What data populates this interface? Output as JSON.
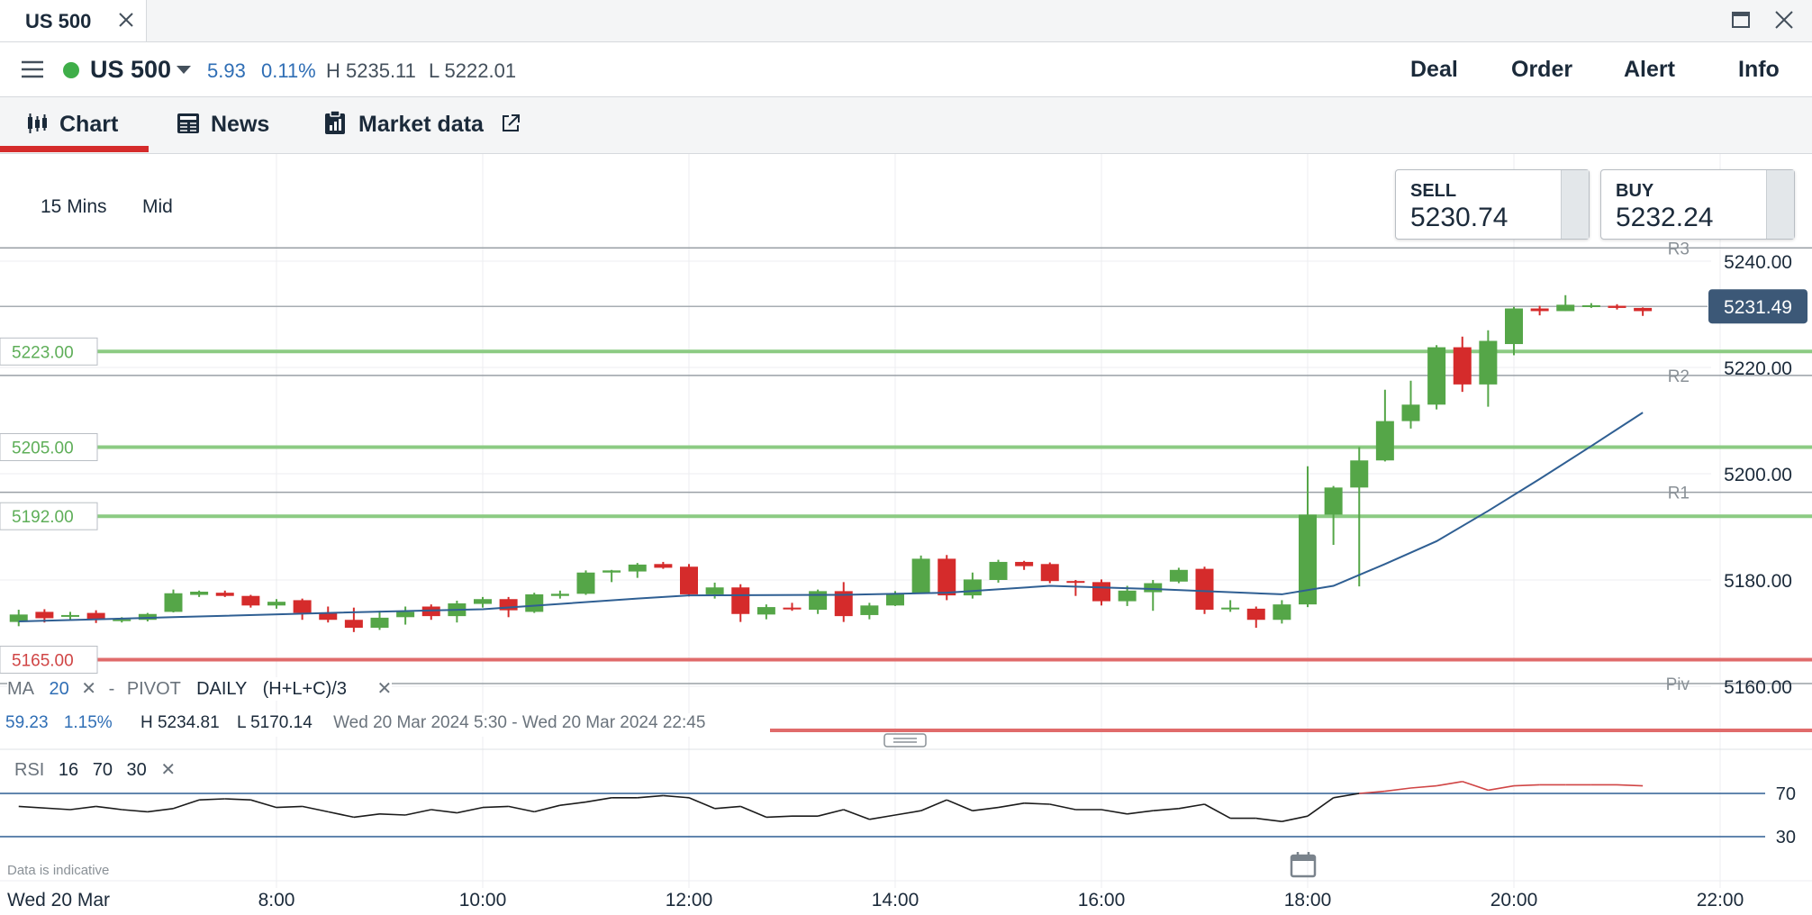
{
  "window": {
    "tab_title": "US 500"
  },
  "instrument": {
    "name": "US 500",
    "change_abs": "5.93",
    "change_pct": "0.11%",
    "high": "H 5235.11",
    "low": "L 5222.01",
    "status_color": "#3fae49"
  },
  "actions": {
    "deal": "Deal",
    "order": "Order",
    "alert": "Alert",
    "info": "Info"
  },
  "section_tabs": [
    {
      "label": "Chart",
      "icon": "candlestick-icon",
      "active": true
    },
    {
      "label": "News",
      "icon": "newspaper-icon",
      "active": false
    },
    {
      "label": "Market data",
      "icon": "clipboard-icon",
      "active": false,
      "external": true
    }
  ],
  "chart_settings": {
    "interval": "15 Mins",
    "price_type": "Mid"
  },
  "quote": {
    "sell_label": "SELL",
    "sell_value": "5230.74",
    "buy_label": "BUY",
    "buy_value": "5232.24"
  },
  "indicators": {
    "ma_name": "MA",
    "ma_period": "20",
    "pivot_name": "PIVOT",
    "pivot_period": "DAILY",
    "pivot_formula": "(H+L+C)/3",
    "rsi_name": "RSI",
    "rsi_period": "16",
    "rsi_upper": "70",
    "rsi_lower": "30"
  },
  "session_stats": {
    "change_abs": "59.23",
    "change_pct": "1.15%",
    "high": "H 5234.81",
    "low": "L 5170.14",
    "range": "Wed 20 Mar 2024 5:30 - Wed 20 Mar 2024 22:45"
  },
  "disclaimer": "Data is indicative",
  "date_label": "Wed 20 Mar",
  "colors": {
    "up": "#55a648",
    "down": "#d52b2b",
    "ma_line": "#2f5f93",
    "alert_line_green": "#8ccb83",
    "alert_line_red": "#e06b6b",
    "pivot_line": "#9aa0a6",
    "current_price_tag": "#3c5877"
  },
  "chart_data": {
    "type": "candlestick",
    "y_axis": {
      "min": 5160,
      "max": 5240,
      "ticks": [
        5240,
        5220,
        5200,
        5180,
        5160
      ],
      "tick_labels": [
        "5240.00",
        "5220.00",
        "5200.00",
        "5180.00",
        "5160.00"
      ]
    },
    "x_axis": {
      "ticks": [
        "8:00",
        "10:00",
        "12:00",
        "14:00",
        "16:00",
        "18:00",
        "20:00",
        "22:00"
      ],
      "tick_hours": [
        8,
        10,
        12,
        14,
        16,
        18,
        20,
        22
      ],
      "range_hours": [
        5.75,
        23.25
      ]
    },
    "current_price": {
      "value": 5231.49,
      "label": "5231.49"
    },
    "pivot_levels": [
      {
        "name": "R3",
        "value": 5242.5
      },
      {
        "name": "R2",
        "value": 5218.5
      },
      {
        "name": "R1",
        "value": 5196.5
      },
      {
        "name": "Piv",
        "value": 5160.5
      }
    ],
    "alert_levels": [
      {
        "label": "5223.00",
        "value": 5223.0,
        "kind": "green"
      },
      {
        "label": "5205.00",
        "value": 5205.0,
        "kind": "green"
      },
      {
        "label": "5192.00",
        "value": 5192.0,
        "kind": "green"
      },
      {
        "label": "5165.00",
        "value": 5165.0,
        "kind": "red"
      }
    ],
    "candles": [
      {
        "t": "5:30",
        "o": 5172.1,
        "h": 5174.4,
        "l": 5171.3,
        "c": 5173.5
      },
      {
        "t": "5:45",
        "o": 5174.0,
        "h": 5174.5,
        "l": 5172.0,
        "c": 5172.8
      },
      {
        "t": "6:00",
        "o": 5173.1,
        "h": 5174.0,
        "l": 5172.5,
        "c": 5173.4
      },
      {
        "t": "6:15",
        "o": 5173.8,
        "h": 5174.3,
        "l": 5171.9,
        "c": 5172.5
      },
      {
        "t": "6:30",
        "o": 5172.6,
        "h": 5173.0,
        "l": 5172.0,
        "c": 5172.6
      },
      {
        "t": "6:45",
        "o": 5172.5,
        "h": 5173.8,
        "l": 5172.2,
        "c": 5173.6
      },
      {
        "t": "7:00",
        "o": 5174.0,
        "h": 5178.2,
        "l": 5173.9,
        "c": 5177.5
      },
      {
        "t": "7:15",
        "o": 5177.2,
        "h": 5178.0,
        "l": 5176.8,
        "c": 5177.8
      },
      {
        "t": "7:30",
        "o": 5177.6,
        "h": 5178.0,
        "l": 5176.8,
        "c": 5177.0
      },
      {
        "t": "7:45",
        "o": 5177.0,
        "h": 5177.2,
        "l": 5174.8,
        "c": 5175.2
      },
      {
        "t": "8:00",
        "o": 5175.2,
        "h": 5176.4,
        "l": 5174.6,
        "c": 5175.9
      },
      {
        "t": "8:15",
        "o": 5176.2,
        "h": 5176.5,
        "l": 5172.5,
        "c": 5173.8
      },
      {
        "t": "8:30",
        "o": 5173.8,
        "h": 5175.0,
        "l": 5172.0,
        "c": 5172.5
      },
      {
        "t": "8:45",
        "o": 5172.5,
        "h": 5174.8,
        "l": 5170.2,
        "c": 5171.0
      },
      {
        "t": "9:00",
        "o": 5171.0,
        "h": 5174.2,
        "l": 5170.6,
        "c": 5172.9
      },
      {
        "t": "9:15",
        "o": 5173.0,
        "h": 5175.0,
        "l": 5171.6,
        "c": 5174.0
      },
      {
        "t": "9:30",
        "o": 5175.0,
        "h": 5175.4,
        "l": 5172.5,
        "c": 5173.2
      },
      {
        "t": "9:45",
        "o": 5173.2,
        "h": 5176.1,
        "l": 5172.0,
        "c": 5175.6
      },
      {
        "t": "10:00",
        "o": 5175.5,
        "h": 5176.8,
        "l": 5174.8,
        "c": 5176.4
      },
      {
        "t": "10:15",
        "o": 5176.4,
        "h": 5176.8,
        "l": 5173.0,
        "c": 5174.3
      },
      {
        "t": "10:30",
        "o": 5174.0,
        "h": 5177.6,
        "l": 5173.8,
        "c": 5177.3
      },
      {
        "t": "10:45",
        "o": 5177.0,
        "h": 5178.0,
        "l": 5176.5,
        "c": 5177.4
      },
      {
        "t": "11:00",
        "o": 5177.4,
        "h": 5181.8,
        "l": 5177.2,
        "c": 5181.4
      },
      {
        "t": "11:15",
        "o": 5181.4,
        "h": 5181.9,
        "l": 5179.6,
        "c": 5181.8
      },
      {
        "t": "11:30",
        "o": 5181.6,
        "h": 5183.2,
        "l": 5180.4,
        "c": 5182.9
      },
      {
        "t": "11:45",
        "o": 5183.0,
        "h": 5183.4,
        "l": 5182.1,
        "c": 5182.3
      },
      {
        "t": "12:00",
        "o": 5182.5,
        "h": 5183.0,
        "l": 5176.9,
        "c": 5177.3
      },
      {
        "t": "12:15",
        "o": 5177.3,
        "h": 5179.5,
        "l": 5176.5,
        "c": 5178.6
      },
      {
        "t": "12:30",
        "o": 5178.6,
        "h": 5179.2,
        "l": 5172.1,
        "c": 5173.6
      },
      {
        "t": "12:45",
        "o": 5173.5,
        "h": 5175.4,
        "l": 5172.6,
        "c": 5174.9
      },
      {
        "t": "13:00",
        "o": 5174.8,
        "h": 5175.7,
        "l": 5174.2,
        "c": 5174.5
      },
      {
        "t": "13:15",
        "o": 5174.4,
        "h": 5178.2,
        "l": 5173.6,
        "c": 5177.9
      },
      {
        "t": "13:30",
        "o": 5177.9,
        "h": 5179.6,
        "l": 5172.1,
        "c": 5173.2
      },
      {
        "t": "13:45",
        "o": 5173.4,
        "h": 5175.7,
        "l": 5172.6,
        "c": 5175.2
      },
      {
        "t": "14:00",
        "o": 5175.2,
        "h": 5177.9,
        "l": 5175.1,
        "c": 5177.5
      },
      {
        "t": "14:15",
        "o": 5177.6,
        "h": 5184.6,
        "l": 5177.5,
        "c": 5184.0
      },
      {
        "t": "14:30",
        "o": 5184.0,
        "h": 5184.7,
        "l": 5176.2,
        "c": 5177.1
      },
      {
        "t": "14:45",
        "o": 5177.1,
        "h": 5181.4,
        "l": 5176.5,
        "c": 5180.1
      },
      {
        "t": "15:00",
        "o": 5180.0,
        "h": 5183.8,
        "l": 5179.5,
        "c": 5183.4
      },
      {
        "t": "15:15",
        "o": 5183.4,
        "h": 5183.6,
        "l": 5181.9,
        "c": 5182.6
      },
      {
        "t": "15:30",
        "o": 5183.0,
        "h": 5183.3,
        "l": 5179.4,
        "c": 5179.8
      },
      {
        "t": "15:45",
        "o": 5179.8,
        "h": 5180.0,
        "l": 5177.0,
        "c": 5179.6
      },
      {
        "t": "16:00",
        "o": 5179.6,
        "h": 5180.1,
        "l": 5175.2,
        "c": 5176.0
      },
      {
        "t": "16:15",
        "o": 5176.0,
        "h": 5178.9,
        "l": 5175.1,
        "c": 5178.0
      },
      {
        "t": "16:30",
        "o": 5177.7,
        "h": 5180.0,
        "l": 5174.2,
        "c": 5179.4
      },
      {
        "t": "16:45",
        "o": 5179.7,
        "h": 5182.3,
        "l": 5179.4,
        "c": 5181.9
      },
      {
        "t": "17:00",
        "o": 5182.1,
        "h": 5182.5,
        "l": 5173.6,
        "c": 5174.4
      },
      {
        "t": "17:15",
        "o": 5174.5,
        "h": 5176.2,
        "l": 5174.0,
        "c": 5174.8
      },
      {
        "t": "17:30",
        "o": 5174.6,
        "h": 5175.0,
        "l": 5171.0,
        "c": 5172.5
      },
      {
        "t": "17:45",
        "o": 5172.5,
        "h": 5176.2,
        "l": 5171.8,
        "c": 5175.4
      },
      {
        "t": "18:00",
        "o": 5175.4,
        "h": 5201.4,
        "l": 5174.9,
        "c": 5192.3
      },
      {
        "t": "18:15",
        "o": 5192.3,
        "h": 5197.7,
        "l": 5186.6,
        "c": 5197.4
      },
      {
        "t": "18:30",
        "o": 5197.4,
        "h": 5205.0,
        "l": 5178.8,
        "c": 5202.5
      },
      {
        "t": "18:45",
        "o": 5202.5,
        "h": 5215.8,
        "l": 5202.3,
        "c": 5209.9
      },
      {
        "t": "19:00",
        "o": 5209.9,
        "h": 5217.5,
        "l": 5208.5,
        "c": 5213.0
      },
      {
        "t": "19:15",
        "o": 5213.0,
        "h": 5224.2,
        "l": 5212.1,
        "c": 5223.8
      },
      {
        "t": "19:30",
        "o": 5223.8,
        "h": 5225.8,
        "l": 5215.4,
        "c": 5216.8
      },
      {
        "t": "19:45",
        "o": 5216.8,
        "h": 5227.0,
        "l": 5212.6,
        "c": 5225.0
      },
      {
        "t": "20:00",
        "o": 5224.4,
        "h": 5231.4,
        "l": 5222.3,
        "c": 5231.1
      },
      {
        "t": "20:15",
        "o": 5231.1,
        "h": 5231.6,
        "l": 5229.8,
        "c": 5230.6
      },
      {
        "t": "20:30",
        "o": 5230.6,
        "h": 5233.6,
        "l": 5230.6,
        "c": 5231.8
      },
      {
        "t": "20:45",
        "o": 5231.4,
        "h": 5232.1,
        "l": 5231.2,
        "c": 5231.7
      },
      {
        "t": "21:00",
        "o": 5231.6,
        "h": 5231.9,
        "l": 5230.9,
        "c": 5231.2
      },
      {
        "t": "21:15",
        "o": 5231.2,
        "h": 5231.3,
        "l": 5229.7,
        "c": 5230.6
      }
    ],
    "ma_line": [
      {
        "t": "5:30",
        "v": 5172.2
      },
      {
        "t": "7:00",
        "v": 5173.0
      },
      {
        "t": "8:30",
        "v": 5173.8
      },
      {
        "t": "10:00",
        "v": 5174.5
      },
      {
        "t": "11:30",
        "v": 5176.5
      },
      {
        "t": "12:00",
        "v": 5177.1
      },
      {
        "t": "13:30",
        "v": 5177.2
      },
      {
        "t": "14:30",
        "v": 5177.6
      },
      {
        "t": "15:30",
        "v": 5178.9
      },
      {
        "t": "16:30",
        "v": 5178.3
      },
      {
        "t": "17:45",
        "v": 5177.3
      },
      {
        "t": "18:15",
        "v": 5178.9
      },
      {
        "t": "18:45",
        "v": 5183.0
      },
      {
        "t": "19:15",
        "v": 5187.3
      },
      {
        "t": "19:45",
        "v": 5193.0
      },
      {
        "t": "20:15",
        "v": 5199.0
      },
      {
        "t": "20:45",
        "v": 5205.2
      },
      {
        "t": "21:15",
        "v": 5211.5
      }
    ],
    "rsi": {
      "ylim": [
        0,
        100
      ],
      "levels": [
        70,
        30
      ],
      "values": [
        {
          "t": "5:30",
          "v": 58
        },
        {
          "t": "6:00",
          "v": 55
        },
        {
          "t": "6:15",
          "v": 58
        },
        {
          "t": "6:30",
          "v": 55
        },
        {
          "t": "6:45",
          "v": 53
        },
        {
          "t": "7:00",
          "v": 56
        },
        {
          "t": "7:15",
          "v": 64
        },
        {
          "t": "7:30",
          "v": 65
        },
        {
          "t": "7:45",
          "v": 64
        },
        {
          "t": "8:00",
          "v": 57
        },
        {
          "t": "8:15",
          "v": 58
        },
        {
          "t": "8:30",
          "v": 53
        },
        {
          "t": "8:45",
          "v": 48
        },
        {
          "t": "9:00",
          "v": 51
        },
        {
          "t": "9:15",
          "v": 50
        },
        {
          "t": "9:30",
          "v": 55
        },
        {
          "t": "9:45",
          "v": 52
        },
        {
          "t": "10:00",
          "v": 57
        },
        {
          "t": "10:15",
          "v": 58
        },
        {
          "t": "10:30",
          "v": 53
        },
        {
          "t": "10:45",
          "v": 59
        },
        {
          "t": "11:00",
          "v": 62
        },
        {
          "t": "11:15",
          "v": 66
        },
        {
          "t": "11:30",
          "v": 66
        },
        {
          "t": "11:45",
          "v": 68
        },
        {
          "t": "12:00",
          "v": 66
        },
        {
          "t": "12:15",
          "v": 56
        },
        {
          "t": "12:30",
          "v": 58
        },
        {
          "t": "12:45",
          "v": 48
        },
        {
          "t": "13:00",
          "v": 49
        },
        {
          "t": "13:15",
          "v": 49
        },
        {
          "t": "13:30",
          "v": 55
        },
        {
          "t": "13:45",
          "v": 46
        },
        {
          "t": "14:00",
          "v": 50
        },
        {
          "t": "14:15",
          "v": 54
        },
        {
          "t": "14:30",
          "v": 64
        },
        {
          "t": "14:45",
          "v": 54
        },
        {
          "t": "15:00",
          "v": 57
        },
        {
          "t": "15:15",
          "v": 61
        },
        {
          "t": "15:30",
          "v": 60
        },
        {
          "t": "15:45",
          "v": 55
        },
        {
          "t": "16:00",
          "v": 55
        },
        {
          "t": "16:15",
          "v": 51
        },
        {
          "t": "16:30",
          "v": 54
        },
        {
          "t": "16:45",
          "v": 56
        },
        {
          "t": "17:00",
          "v": 60
        },
        {
          "t": "17:15",
          "v": 47
        },
        {
          "t": "17:30",
          "v": 47
        },
        {
          "t": "17:45",
          "v": 44
        },
        {
          "t": "18:00",
          "v": 49
        },
        {
          "t": "18:15",
          "v": 66
        },
        {
          "t": "18:30",
          "v": 70
        },
        {
          "t": "18:45",
          "v": 72
        },
        {
          "t": "19:00",
          "v": 75
        },
        {
          "t": "19:15",
          "v": 77
        },
        {
          "t": "19:30",
          "v": 81
        },
        {
          "t": "19:45",
          "v": 73
        },
        {
          "t": "20:00",
          "v": 77
        },
        {
          "t": "20:15",
          "v": 78
        },
        {
          "t": "20:30",
          "v": 78
        },
        {
          "t": "20:45",
          "v": 78
        },
        {
          "t": "21:00",
          "v": 78
        },
        {
          "t": "21:15",
          "v": 77
        }
      ]
    }
  }
}
